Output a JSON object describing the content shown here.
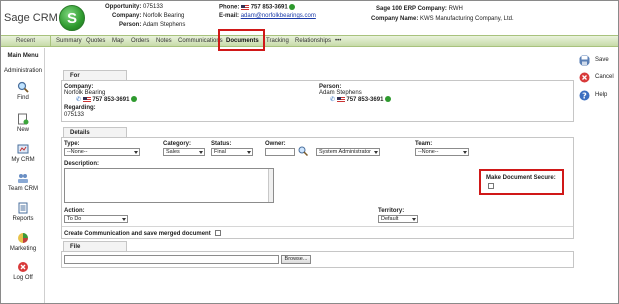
{
  "header": {
    "brand": "Sage CRM",
    "logo_letter": "S",
    "opportunity_label": "Opportunity:",
    "opportunity_value": "075133",
    "company_label": "Company:",
    "company_value": "Norfolk Bearing",
    "person_label": "Person:",
    "person_value": "Adam Stephens",
    "phone_label": "Phone:",
    "phone_value": "757 853-3691",
    "email_label": "E-mail:",
    "email_value": "adam@norfolkbearings.com",
    "erp_label": "Sage 100 ERP Company:",
    "erp_value": "RWH",
    "company_name_label": "Company Name:",
    "company_name_value": "KWS Manufacturing Company, Ltd."
  },
  "tabs": {
    "recent": "Recent",
    "items": [
      "Summary",
      "Quotes",
      "Map",
      "Orders",
      "Notes",
      "Communications",
      "Documents",
      "Tracking",
      "Relationships",
      "•••"
    ]
  },
  "leftnav": {
    "title": "Main Menu",
    "subtitle": "Administration",
    "items": [
      "Find",
      "New",
      "My CRM",
      "Team CRM",
      "Reports",
      "Marketing",
      "Log Off"
    ]
  },
  "actions": [
    "Save",
    "Cancel",
    "Help"
  ],
  "for_panel": {
    "title": "For",
    "company_label": "Company:",
    "company_value": "Norfolk Bearing",
    "company_phone": "757 853-3691",
    "regarding_label": "Regarding:",
    "regarding_value": "075133",
    "person_label": "Person:",
    "person_value": "Adam Stephens",
    "person_phone": "757 853-3691"
  },
  "details": {
    "title": "Details",
    "type_label": "Type:",
    "type_value": "--None--",
    "category_label": "Category:",
    "category_value": "Sales",
    "status_label": "Status:",
    "status_value": "Final",
    "owner_label": "Owner:",
    "owner_value": "System Administrator",
    "team_label": "Team:",
    "team_value": "--None--",
    "description_label": "Description:",
    "secure_label": "Make Document Secure:",
    "action_label": "Action:",
    "action_value": "To Do",
    "territory_label": "Territory:",
    "territory_value": "Default",
    "create_comm_label": "Create Communication and save merged document"
  },
  "file": {
    "title": "File",
    "browse_label": "Browse..."
  }
}
